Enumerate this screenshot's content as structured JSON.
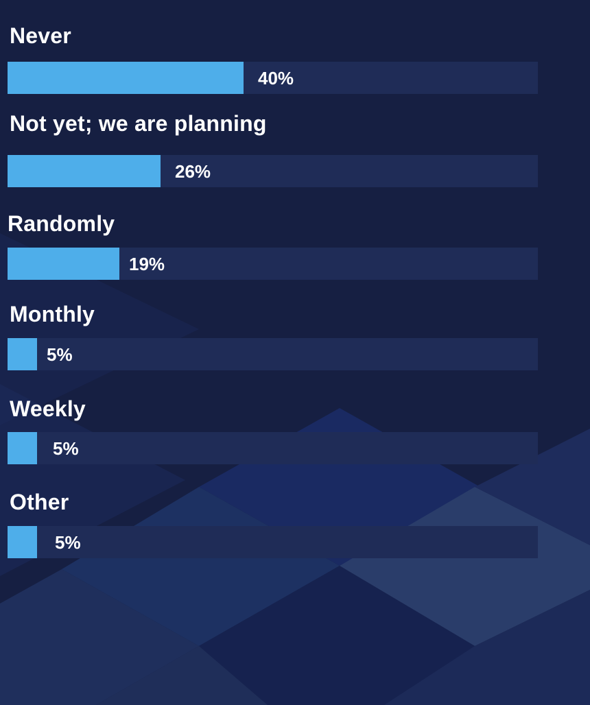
{
  "colors": {
    "background": "#161f42",
    "track": "#1f2c57",
    "fill": "#4eaeea",
    "text": "#ffffff"
  },
  "chart_data": {
    "type": "bar",
    "orientation": "horizontal",
    "categories": [
      "Never",
      "Not yet; we are planning",
      "Randomly",
      "Monthly",
      "Weekly",
      "Other"
    ],
    "values": [
      40,
      26,
      19,
      5,
      5,
      5
    ],
    "value_labels": [
      "40%",
      "26%",
      "19%",
      "5%",
      "5%",
      "5%"
    ],
    "unit": "%",
    "xlim": [
      0,
      90
    ],
    "grid": false,
    "legend": "none"
  }
}
